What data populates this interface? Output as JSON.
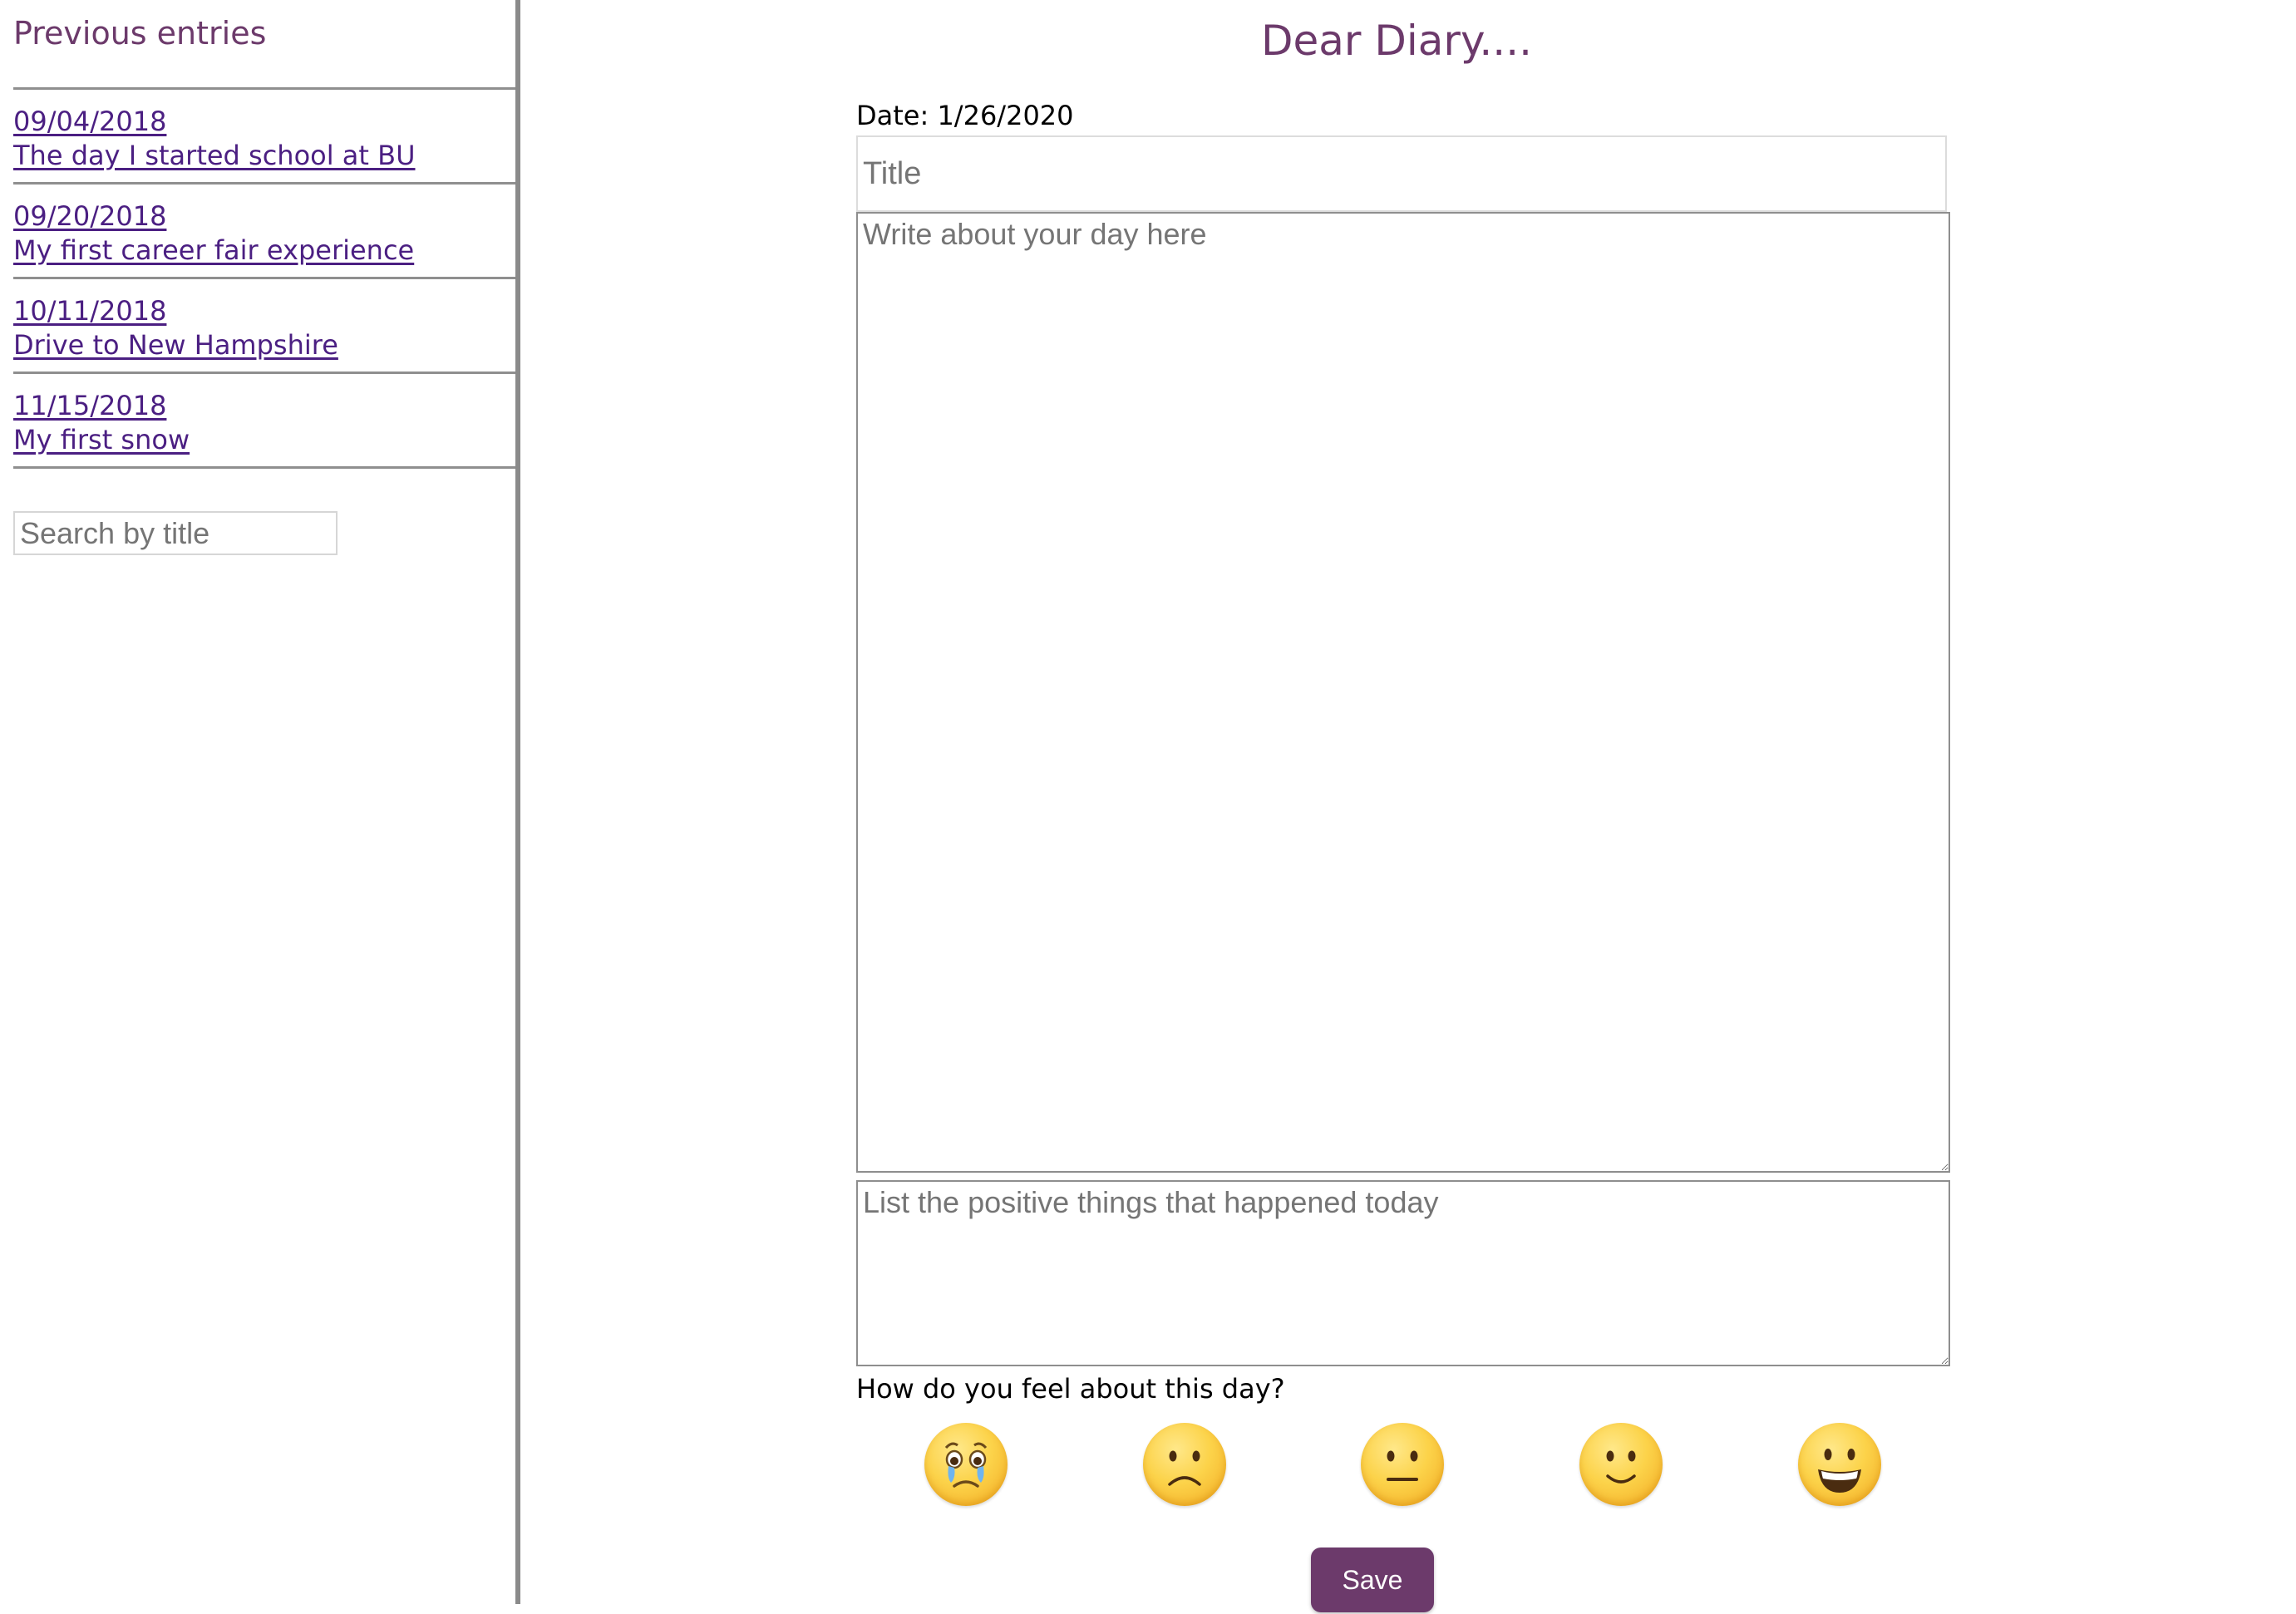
{
  "sidebar": {
    "heading": "Previous entries",
    "entries": [
      {
        "date": "09/04/2018",
        "title": "The day I started school at BU"
      },
      {
        "date": "09/20/2018",
        "title": "My first career fair experience"
      },
      {
        "date": "10/11/2018",
        "title": "Drive to New Hampshire"
      },
      {
        "date": "11/15/2018",
        "title": "My first snow"
      }
    ],
    "search_placeholder": "Search by title"
  },
  "main": {
    "title": "Dear Diary....",
    "date_label": "Date: 1/26/2020",
    "title_placeholder": "Title",
    "diary_placeholder": "Write about your day here",
    "positive_placeholder": "List the positive things that happened today",
    "feel_question": "How do you feel about this day?",
    "moods": [
      "very-sad-face-icon",
      "sad-face-icon",
      "neutral-face-icon",
      "slight-smile-face-icon",
      "grinning-face-icon"
    ],
    "save_label": "Save"
  },
  "colors": {
    "accent": "#6c3a6b",
    "link": "#4b1f82",
    "divider": "#8a8a8a"
  }
}
